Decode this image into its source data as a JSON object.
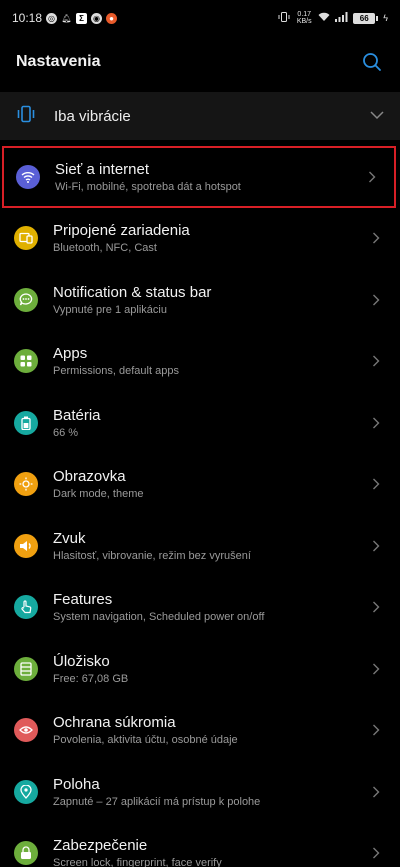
{
  "status_bar": {
    "time": "10:18",
    "network_label": "0.17 KB/s",
    "battery": "66"
  },
  "header": {
    "title": "Nastavenia"
  },
  "vibrate": {
    "label": "Iba vibrácie"
  },
  "items": [
    {
      "title": "Sieť a internet",
      "subtitle": "Wi-Fi, mobilné, spotreba dát a hotspot",
      "color": "#5a5fd6",
      "icon": "wifi-icon"
    },
    {
      "title": "Pripojené zariadenia",
      "subtitle": "Bluetooth, NFC, Cast",
      "color": "#e0b000",
      "icon": "devices-icon"
    },
    {
      "title": "Notification & status bar",
      "subtitle": "Vypnuté pre 1 aplikáciu",
      "color": "#6dae3c",
      "icon": "chat-icon"
    },
    {
      "title": "Apps",
      "subtitle": "Permissions, default apps",
      "color": "#6dae3c",
      "icon": "apps-icon"
    },
    {
      "title": "Batéria",
      "subtitle": "66 %",
      "color": "#16a9a0",
      "icon": "battery-icon"
    },
    {
      "title": "Obrazovka",
      "subtitle": "Dark mode, theme",
      "color": "#f0a010",
      "icon": "brightness-icon"
    },
    {
      "title": "Zvuk",
      "subtitle": "Hlasitosť, vibrovanie, režim bez vyrušení",
      "color": "#f0a010",
      "icon": "volume-icon"
    },
    {
      "title": "Features",
      "subtitle": "System navigation, Scheduled power on/off",
      "color": "#16a9a0",
      "icon": "hand-icon"
    },
    {
      "title": "Úložisko",
      "subtitle": "Free: 67,08 GB",
      "color": "#6dae3c",
      "icon": "storage-icon"
    },
    {
      "title": "Ochrana súkromia",
      "subtitle": "Povolenia, aktivita účtu, osobné údaje",
      "color": "#e05a5a",
      "icon": "privacy-eye-icon"
    },
    {
      "title": "Poloha",
      "subtitle": "Zapnuté – 27 aplikácií má prístup k polohe",
      "color": "#16a9a0",
      "icon": "location-icon"
    },
    {
      "title": "Zabezpečenie",
      "subtitle": "Screen lock, fingerprint, face verify",
      "color": "#6dae3c",
      "icon": "lock-icon"
    }
  ]
}
